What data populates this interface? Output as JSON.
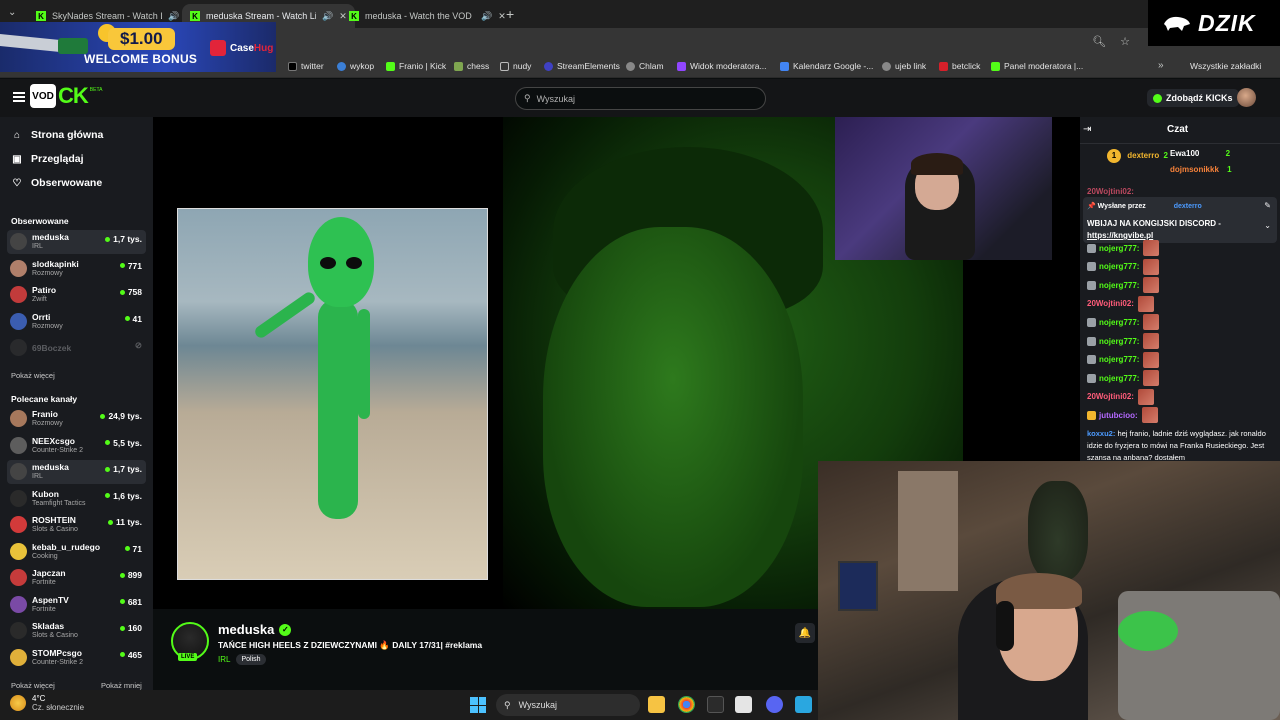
{
  "browser": {
    "tabs": [
      {
        "title": "SkyNades Stream - Watch L",
        "active": false
      },
      {
        "title": "meduska Stream - Watch Li",
        "active": true
      },
      {
        "title": "meduska - Watch the VOD",
        "active": false
      }
    ],
    "new_tab_symbol": "+",
    "bookmarks": [
      {
        "label": "twitter"
      },
      {
        "label": "wykop"
      },
      {
        "label": "Franio | Kick"
      },
      {
        "label": "chess"
      },
      {
        "label": "nudy"
      },
      {
        "label": "StreamElements"
      },
      {
        "label": "Chlam"
      },
      {
        "label": "Widok moderatora..."
      },
      {
        "label": "Kalendarz Google -..."
      },
      {
        "label": "ujeb link"
      },
      {
        "label": "betclick"
      },
      {
        "label": "Panel moderatora |..."
      }
    ],
    "all_bookmarks": "Wszystkie zakładki"
  },
  "ad": {
    "amount": "$1.00",
    "text": "WELCOME BONUS",
    "brand_a": "Case",
    "brand_b": "Hug"
  },
  "overlay_brand": "DZIK",
  "header": {
    "logo_box": "VOD",
    "logo_text": "CK",
    "logo_beta": "BETA",
    "search_placeholder": "Wyszukaj",
    "get_kicks": "Zdobądź KICKs"
  },
  "sidebar": {
    "nav": [
      {
        "label": "Strona główna",
        "icon": "home-icon",
        "glyph": "⌂"
      },
      {
        "label": "Przeglądaj",
        "icon": "browse-icon",
        "glyph": "▣"
      },
      {
        "label": "Obserwowane",
        "icon": "heart-icon",
        "glyph": "♡"
      }
    ],
    "followed_title": "Obserwowane",
    "followed": [
      {
        "name": "meduska",
        "category": "IRL",
        "viewers": "1,7 tys.",
        "color": "#444",
        "selected": true
      },
      {
        "name": "slodkapinki",
        "category": "Rozmowy",
        "viewers": "771",
        "color": "#b07f6a"
      },
      {
        "name": "Patiro",
        "category": "Zwift",
        "viewers": "758",
        "color": "#c23b3b"
      },
      {
        "name": "Orrti",
        "category": "Rozmowy",
        "viewers": "41",
        "color": "#3b5db0"
      },
      {
        "name": "69Boczek",
        "offline": true,
        "color": "#3a3a3a"
      }
    ],
    "show_more_1": "Pokaż więcej",
    "recommended_title": "Polecane kanały",
    "recommended": [
      {
        "name": "Franio",
        "category": "Rozmowy",
        "viewers": "24,9 tys.",
        "color": "#a6785c"
      },
      {
        "name": "NEEXcsgo",
        "category": "Counter-Strike 2",
        "viewers": "5,5 tys.",
        "color": "#5d5d5d"
      },
      {
        "name": "meduska",
        "category": "IRL",
        "viewers": "1,7 tys.",
        "color": "#444",
        "selected": true
      },
      {
        "name": "Kubon",
        "category": "Teamfight Tactics",
        "viewers": "1,6 tys.",
        "color": "#2a2a2a"
      },
      {
        "name": "ROSHTEIN",
        "category": "Slots & Casino",
        "viewers": "11 tys.",
        "color": "#d23a3a"
      },
      {
        "name": "kebab_u_rudego",
        "category": "Cooking",
        "viewers": "71",
        "color": "#e9c23a"
      },
      {
        "name": "Japczan",
        "category": "Fortnite",
        "viewers": "899",
        "color": "#c53b3b"
      },
      {
        "name": "AspenTV",
        "category": "Fortnite",
        "viewers": "681",
        "color": "#7a4aa6"
      },
      {
        "name": "Skladas",
        "category": "Slots & Casino",
        "viewers": "160",
        "color": "#2a2a2a"
      },
      {
        "name": "STOMPcsgo",
        "category": "Counter-Strike 2",
        "viewers": "465",
        "color": "#e0b03a"
      }
    ],
    "show_more_2": "Pokaż więcej",
    "show_less": "Pokaż mniej"
  },
  "stream": {
    "name": "meduska",
    "title": "TAŃCE HIGH HEELS Z DZIEWCZYNAMI 🔥 DAILY 17/31| #reklama",
    "category": "IRL",
    "tag": "Polish",
    "live": "LIVE"
  },
  "chat": {
    "title": "Czat",
    "leaders": [
      {
        "rank": "1",
        "name": "dexterro",
        "value": "2"
      },
      {
        "name": "Ewa100",
        "value": "2"
      },
      {
        "name": "dojmsonikkk",
        "value": "1"
      }
    ],
    "cut_name": "20Wojtini02:",
    "pinned_by_label": "Wysłane przez",
    "pinned_by": "dexterro",
    "pinned_msg": "WBIJAJ NA KONGIJSKI DISCORD -",
    "pinned_link": "https://kngvibe.pl",
    "messages": [
      {
        "user": "nojerg777:",
        "color": "#53fc18"
      },
      {
        "user": "nojerg777:",
        "color": "#53fc18"
      },
      {
        "user": "nojerg777:",
        "color": "#53fc18"
      },
      {
        "user": "20Wojtini02:",
        "color": "#ff5c7a"
      },
      {
        "user": "nojerg777:",
        "color": "#53fc18"
      },
      {
        "user": "nojerg777:",
        "color": "#53fc18"
      },
      {
        "user": "nojerg777:",
        "color": "#53fc18"
      },
      {
        "user": "nojerg777:",
        "color": "#53fc18"
      },
      {
        "user": "20Wojtini02:",
        "color": "#ff5c7a"
      },
      {
        "user": "jutubcioo:",
        "color": "#b469ff"
      }
    ],
    "long_user": "koxxu2:",
    "long_text": " hej franio, ladnie dziś wyglądasz. jak ronaldo idzie do fryzjera to mówi na Franka Rusieckiego. Jest szansa na anbana? dostałem"
  },
  "taskbar": {
    "temp": "4°C",
    "weather": "Cz. słonecznie",
    "search": "Wyszukaj"
  }
}
